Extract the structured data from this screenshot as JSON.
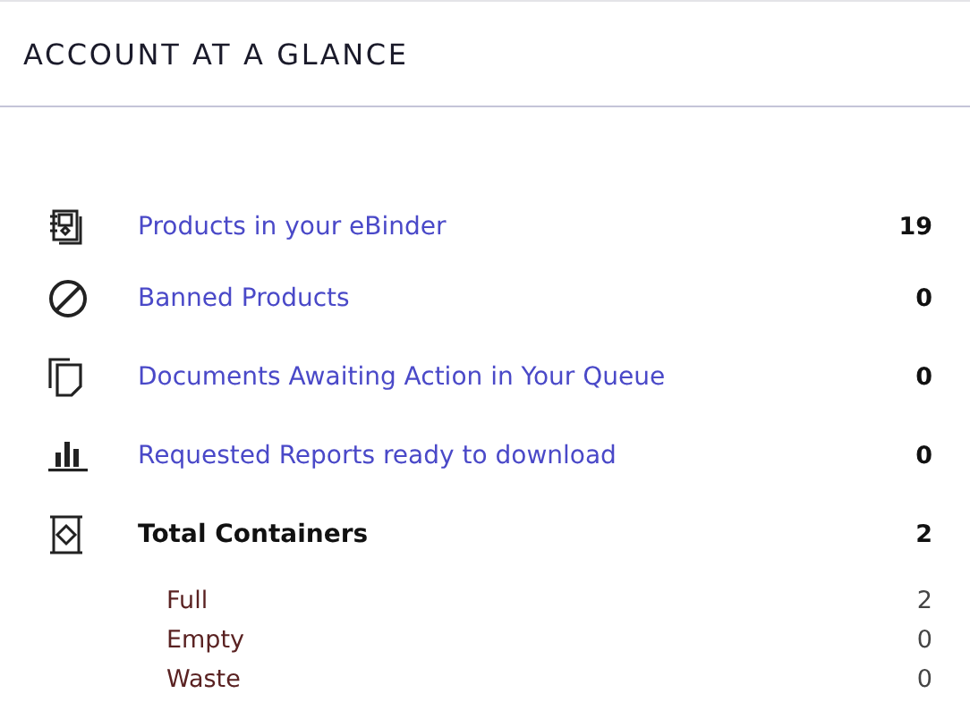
{
  "title": "ACCOUNT AT A GLANCE",
  "rows": [
    {
      "kind": "link",
      "label": "Products in your eBinder",
      "value": "19"
    },
    {
      "kind": "link",
      "label": "Banned Products",
      "value": "0"
    },
    {
      "kind": "link",
      "label": "Documents Awaiting Action in Your Queue",
      "value": "0"
    },
    {
      "kind": "link",
      "label": "Requested Reports ready to download",
      "value": "0"
    },
    {
      "kind": "total",
      "label": "Total Containers",
      "value": "2",
      "children": [
        {
          "label": "Full",
          "value": "2"
        },
        {
          "label": "Empty",
          "value": "0"
        },
        {
          "label": "Waste",
          "value": "0"
        }
      ]
    }
  ]
}
